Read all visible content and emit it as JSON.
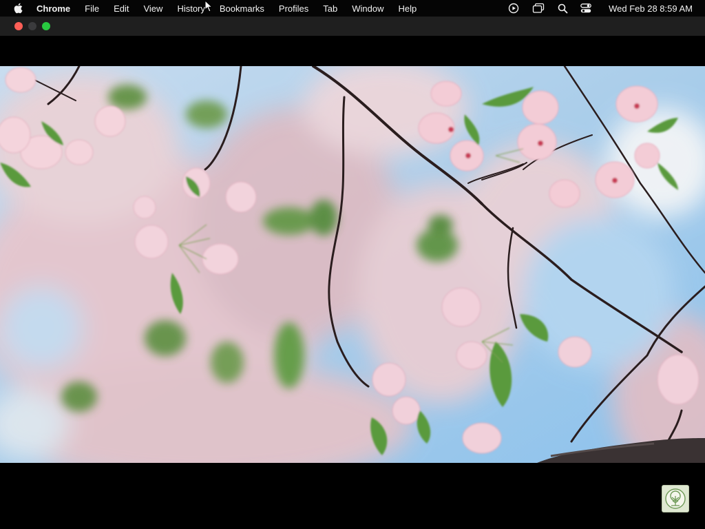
{
  "menubar": {
    "apple_icon": "apple-logo-icon",
    "app_name": "Chrome",
    "items": [
      "File",
      "Edit",
      "View",
      "History",
      "Bookmarks",
      "Profiles",
      "Tab",
      "Window",
      "Help"
    ],
    "status_icons": [
      "play-circle-icon",
      "screen-mirroring-icon",
      "spotlight-search-icon",
      "control-center-icon"
    ],
    "clock": "Wed Feb 28  8:59 AM"
  },
  "window": {
    "traffic_lights": {
      "close": "#ff5f57",
      "minimize": "#3b3b3d",
      "zoom": "#28c840"
    }
  },
  "video": {
    "mode": "fullscreen",
    "subject_icon": "cherry-blossom-video-frame",
    "channel_logo_icon": "tree-logo-icon",
    "accent_colors": {
      "sky": "#9ccbeb",
      "blossom": "#f1c9d2",
      "leaf": "#5b9a3c",
      "branch": "#2a1d1e"
    }
  }
}
